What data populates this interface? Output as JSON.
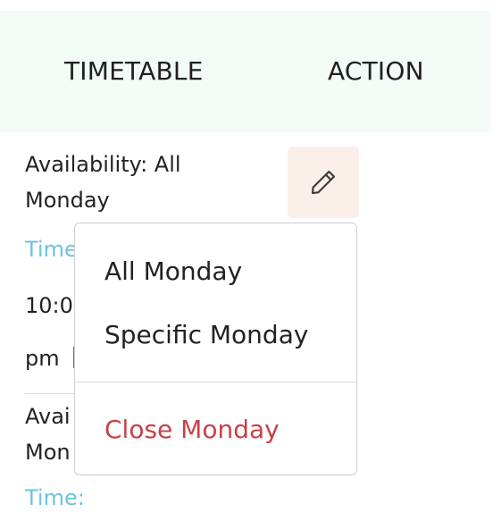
{
  "header": {
    "columns": [
      "TIMETABLE",
      "ACTION"
    ]
  },
  "rows": [
    {
      "availability_line1": "Availability: All",
      "availability_line2": "Monday",
      "time_label": "Time",
      "time_value_line1": "10:0",
      "time_value_line2": "pm"
    },
    {
      "availability_line1": "Avai",
      "availability_line2": "Mon",
      "time_label": "Time:"
    }
  ],
  "edit_button": {
    "icon": "pencil-icon"
  },
  "dropdown": {
    "items": [
      {
        "label": "All Monday"
      },
      {
        "label": "Specific Monday"
      },
      {
        "label": "Close Monday",
        "color": "#c8414a"
      }
    ]
  },
  "colors": {
    "header_bg": "#f3fbf7",
    "time_label": "#6cc3e0",
    "edit_button_bg": "#fbefea",
    "danger": "#c8414a"
  }
}
